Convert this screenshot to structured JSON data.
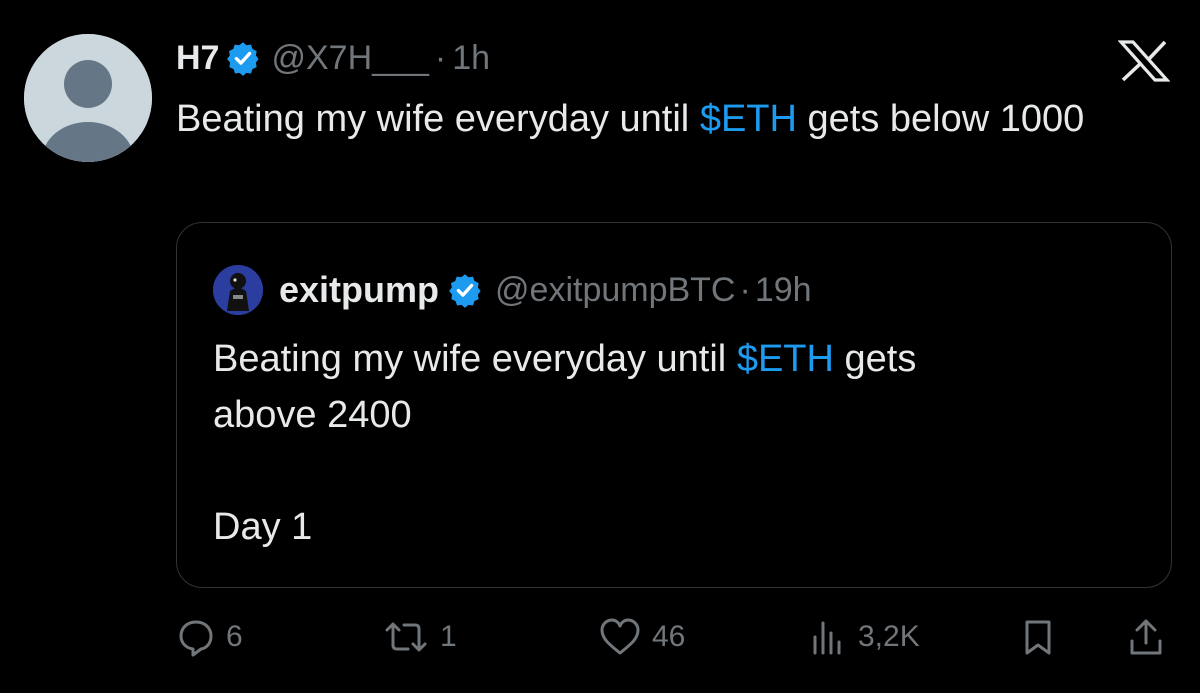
{
  "tweet": {
    "author_name": "H7",
    "author_handle": "@X7H___",
    "separator": "·",
    "time": "1h",
    "text_before": "Beating my wife everyday until ",
    "cashtag": "$ETH",
    "text_after": " gets below 1000"
  },
  "quote": {
    "author_name": "exitpump",
    "author_handle": "@exitpumpBTC",
    "separator": "·",
    "time": "19h",
    "text_before": "Beating my wife everyday until ",
    "cashtag": "$ETH",
    "text_after": " gets\nabove 2400\n\nDay 1"
  },
  "actions": {
    "replies": "6",
    "reposts": "1",
    "likes": "46",
    "views": "3,2K"
  },
  "icons": {
    "avatar": "default-avatar-icon",
    "verified": "verified-badge-icon",
    "logo": "x-logo-icon",
    "reply": "reply-icon",
    "repost": "repost-icon",
    "like": "heart-icon",
    "views": "views-icon",
    "bookmark": "bookmark-icon",
    "share": "share-icon"
  },
  "colors": {
    "background": "#000000",
    "text": "#e7e9ea",
    "muted": "#71767b",
    "accent": "#1d9bf0",
    "border": "#2f3336"
  }
}
